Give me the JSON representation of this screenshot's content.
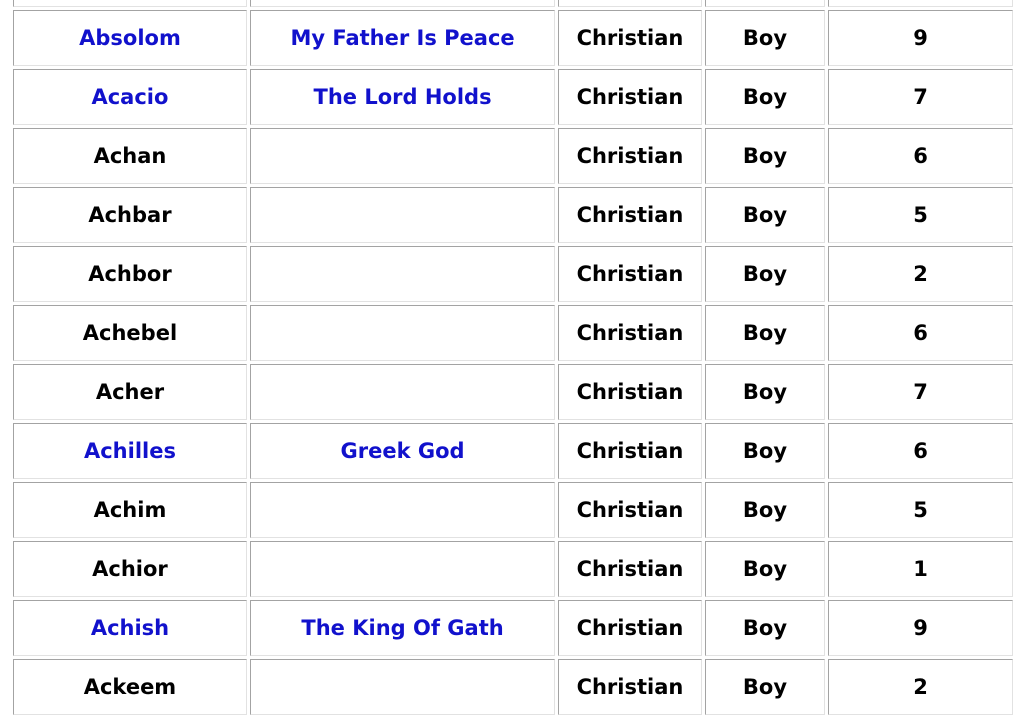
{
  "rows": [
    {
      "name": "",
      "meaning": "",
      "origin": "",
      "gender": "",
      "number": "",
      "linked": false
    },
    {
      "name": "Absolom",
      "meaning": "My Father Is Peace",
      "origin": "Christian",
      "gender": "Boy",
      "number": "9",
      "linked": true
    },
    {
      "name": "Acacio",
      "meaning": "The Lord Holds",
      "origin": "Christian",
      "gender": "Boy",
      "number": "7",
      "linked": true
    },
    {
      "name": "Achan",
      "meaning": "",
      "origin": "Christian",
      "gender": "Boy",
      "number": "6",
      "linked": false
    },
    {
      "name": "Achbar",
      "meaning": "",
      "origin": "Christian",
      "gender": "Boy",
      "number": "5",
      "linked": false
    },
    {
      "name": "Achbor",
      "meaning": "",
      "origin": "Christian",
      "gender": "Boy",
      "number": "2",
      "linked": false
    },
    {
      "name": "Achebel",
      "meaning": "",
      "origin": "Christian",
      "gender": "Boy",
      "number": "6",
      "linked": false
    },
    {
      "name": "Acher",
      "meaning": "",
      "origin": "Christian",
      "gender": "Boy",
      "number": "7",
      "linked": false
    },
    {
      "name": "Achilles",
      "meaning": "Greek God",
      "origin": "Christian",
      "gender": "Boy",
      "number": "6",
      "linked": true
    },
    {
      "name": "Achim",
      "meaning": "",
      "origin": "Christian",
      "gender": "Boy",
      "number": "5",
      "linked": false
    },
    {
      "name": "Achior",
      "meaning": "",
      "origin": "Christian",
      "gender": "Boy",
      "number": "1",
      "linked": false
    },
    {
      "name": "Achish",
      "meaning": "The King Of Gath",
      "origin": "Christian",
      "gender": "Boy",
      "number": "9",
      "linked": true
    },
    {
      "name": "Ackeem",
      "meaning": "",
      "origin": "Christian",
      "gender": "Boy",
      "number": "2",
      "linked": false
    }
  ],
  "colors": {
    "link": "#1111cc",
    "text": "#000000",
    "border_dark": "#a3a3a3",
    "border_light": "#e2e2e2"
  }
}
